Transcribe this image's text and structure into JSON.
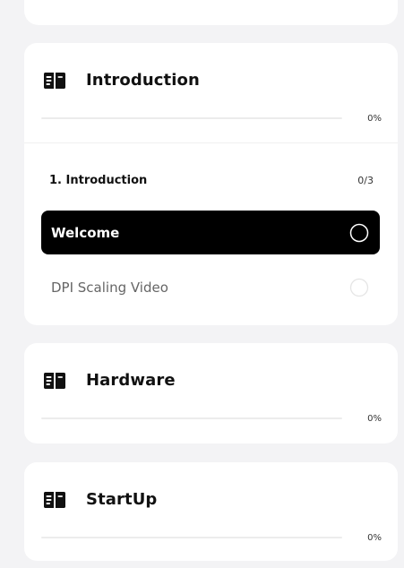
{
  "modules": {
    "introduction": {
      "title": "Introduction",
      "progress_text": "0%",
      "progress_value": 0,
      "section": {
        "title": "1. Introduction",
        "count": "0/3"
      },
      "lessons": [
        {
          "label": "Welcome",
          "state": "active"
        },
        {
          "label": "DPI Scaling Video",
          "state": "inactive"
        }
      ]
    },
    "hardware": {
      "title": "Hardware",
      "progress_text": "0%",
      "progress_value": 0
    },
    "startup": {
      "title": "StartUp",
      "progress_text": "0%",
      "progress_value": 0
    }
  },
  "icons": {
    "module_icon": "book-icon",
    "lesson_state_icon": "circle-icon"
  },
  "colors": {
    "background": "#f3f3f5",
    "card": "#ffffff",
    "text_primary": "#111111",
    "text_secondary": "#666666",
    "active_lesson": "#000000",
    "progress_track": "#ececec",
    "progress_fill": "#111111"
  }
}
